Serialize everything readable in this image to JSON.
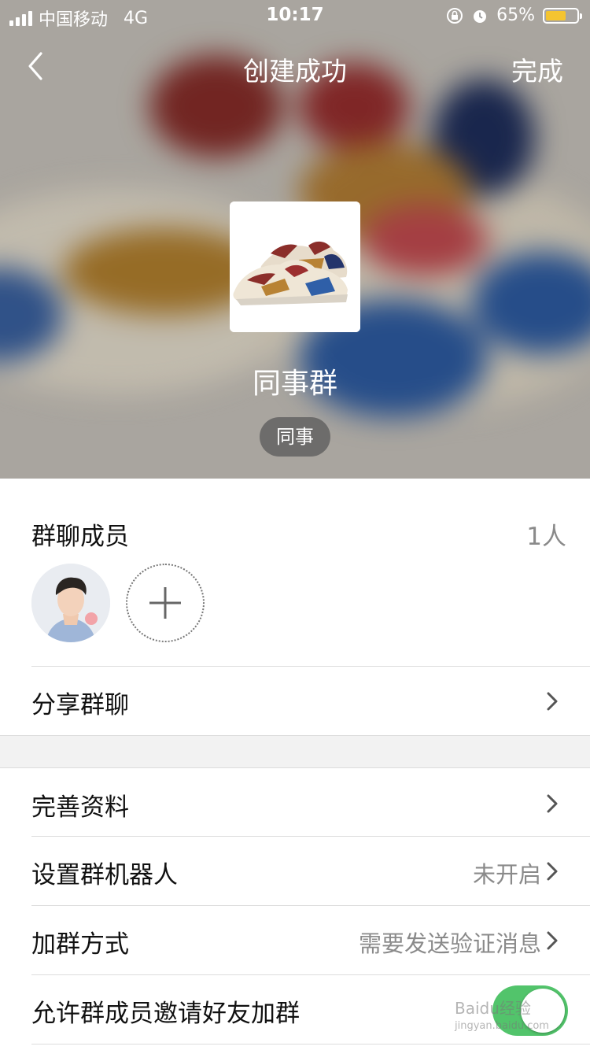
{
  "status_bar": {
    "carrier": "中国移动",
    "network": "4G",
    "time": "10:17",
    "battery_percent": "65%",
    "battery_level": 0.65
  },
  "nav": {
    "title": "创建成功",
    "done_label": "完成"
  },
  "group": {
    "name": "同事群",
    "tag": "同事"
  },
  "members": {
    "title": "群聊成员",
    "count": "1人"
  },
  "rows": {
    "share": {
      "label": "分享群聊"
    },
    "profile": {
      "label": "完善资料"
    },
    "robot": {
      "label": "设置群机器人",
      "value": "未开启"
    },
    "join_method": {
      "label": "加群方式",
      "value": "需要发送验证消息"
    },
    "invite": {
      "label": "允许群成员邀请好友加群",
      "enabled": true
    }
  },
  "colors": {
    "toggle_on": "#52c46b",
    "battery": "#f4c430"
  },
  "watermark": {
    "line1": "Baidu经验",
    "line2": "jingyan.baidu.com"
  }
}
